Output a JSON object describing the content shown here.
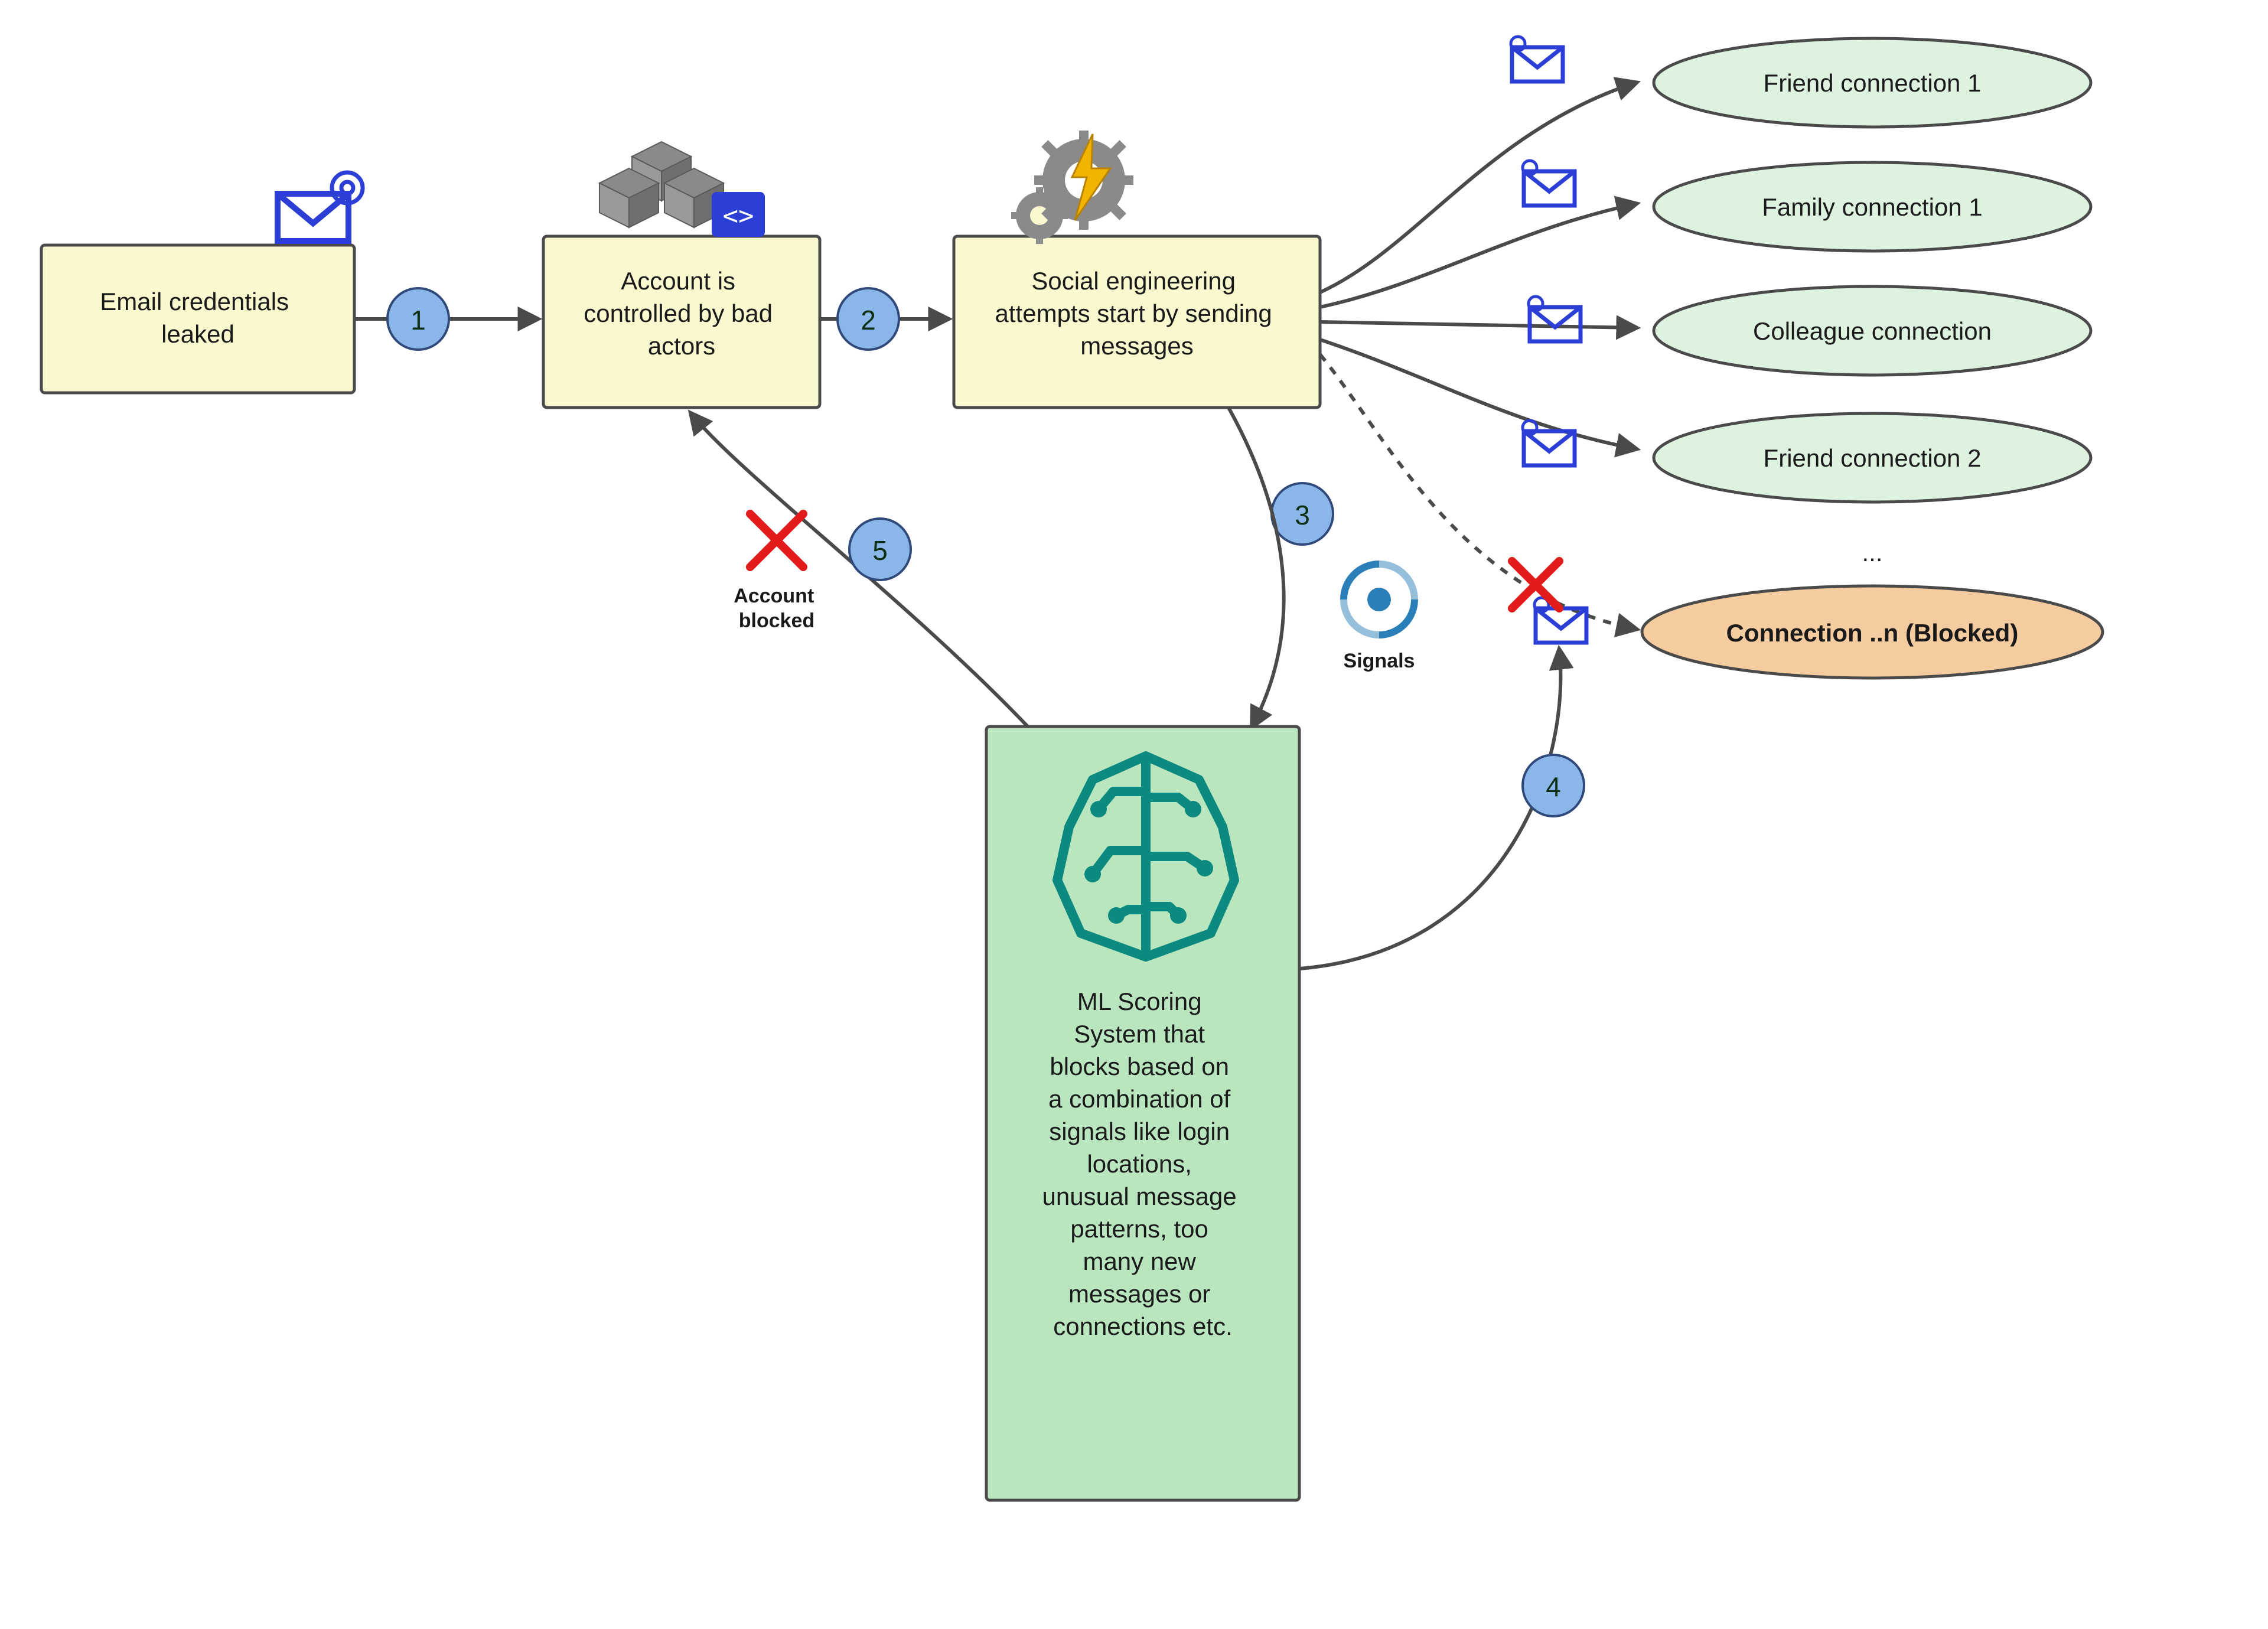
{
  "boxes": {
    "email": "Email credentials leaked",
    "account": "Account is controlled by bad actors",
    "social": "Social engineering attempts start by sending messages",
    "ml": "ML Scoring System that blocks based on a combination of signals like login locations, unusual message patterns, too many new messages or connections etc."
  },
  "connections": {
    "c1": "Friend connection 1",
    "c2": "Family connection 1",
    "c3": "Colleague connection",
    "c4": "Friend connection 2",
    "more": "...",
    "blocked": "Connection ..n (Blocked)"
  },
  "badges": {
    "b1": "1",
    "b2": "2",
    "b3": "3",
    "b4": "4",
    "b5": "5"
  },
  "labels": {
    "signals": "Signals",
    "accountBlocked1": "Account",
    "accountBlocked2": "blocked"
  }
}
